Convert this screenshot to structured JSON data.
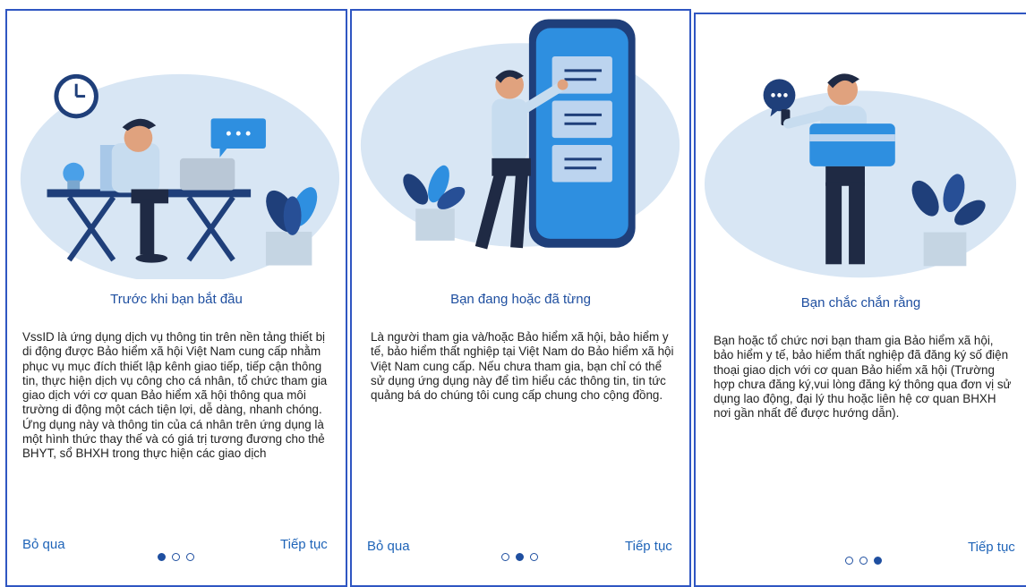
{
  "screens": [
    {
      "title": "Trước khi bạn bắt đầu",
      "body": "VssID là ứng dụng dịch vụ thông tin trên nền tảng thiết bị di động được  Bảo hiểm xã hội Việt Nam cung cấp nhằm phục vụ mục đích thiết lập kênh giao tiếp, tiếp cận thông tin, thực hiện dịch vụ công cho cá nhân, tổ chức tham gia giao dịch với cơ quan Bảo hiểm xã hội thông qua môi trường di động một cách tiện lợi, dễ dàng, nhanh chóng. Ứng dụng này và thông tin của cá nhân trên ứng dụng là một hình thức thay thế và có giá trị tương đương cho thẻ BHYT, sổ BHXH trong thực hiện các giao dịch",
      "skip_label": "Bỏ qua",
      "next_label": "Tiếp tục",
      "active_dot": 0
    },
    {
      "title": "Bạn đang hoặc đã từng",
      "body": "Là người tham gia và/hoặc Bảo hiểm xã hội, bảo hiểm y tế, bảo hiểm thất nghiệp tại Việt Nam do Bảo hiểm xã hội Việt Nam cung cấp. Nếu chưa tham gia, bạn chỉ có thể sử dụng ứng dụng này để tìm hiểu các thông tin, tin tức quảng bá do chúng tôi cung cấp chung cho cộng đồng.",
      "skip_label": "Bỏ qua",
      "next_label": "Tiếp tục",
      "active_dot": 1
    },
    {
      "title": "Bạn chắc chắn rằng",
      "body": "Bạn hoặc tổ chức nơi bạn tham gia Bảo hiểm xã hội, bảo hiểm y tế, bảo hiểm thất nghiệp đã đăng ký số điện thoại giao dịch với cơ quan Bảo hiểm xã hội (Trường hợp chưa đăng ký,vui lòng đăng ký thông qua đơn vị sử dụng lao động, đại lý thu hoặc liên hệ cơ quan BHXH nơi gần nhất để được hướng dẫn).",
      "next_label": "Tiếp tục",
      "active_dot": 2
    }
  ],
  "colors": {
    "accent": "#1f4fa0",
    "link": "#1f64b8",
    "border": "#2f56c2",
    "illustration_bg": "#d8e6f4"
  }
}
